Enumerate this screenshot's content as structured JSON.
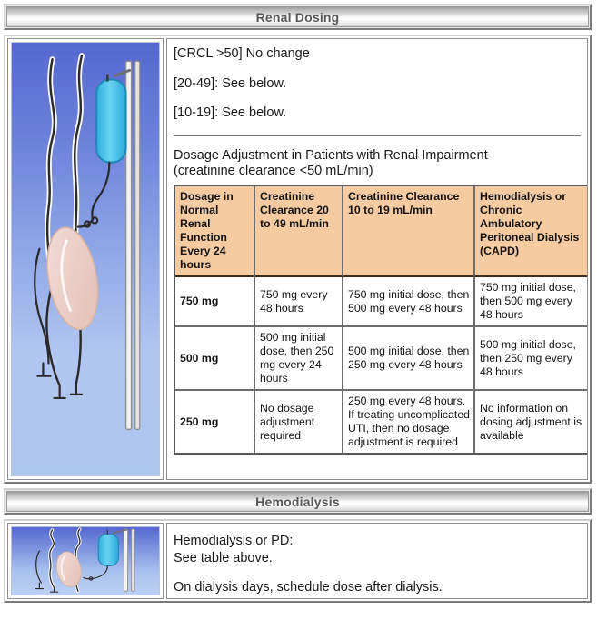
{
  "sections": [
    {
      "title": "Renal Dosing",
      "illustration": "dialysis-patient-icon",
      "crcl_lines": [
        "[CRCL >50] No change",
        "[20-49]: See below.",
        "[10-19]: See below."
      ],
      "table_caption_line1": "Dosage Adjustment in Patients with Renal Impairment",
      "table_caption_line2": "(creatinine clearance <50 mL/min)",
      "table": {
        "headers": [
          "Dosage in Normal Renal Function Every 24 hours",
          "Creatinine Clearance 20 to 49 mL/min",
          "Creatinine Clearance 10 to 19 mL/min",
          "Hemodialysis or Chronic Ambulatory Peritoneal Dialysis (CAPD)"
        ],
        "rows": [
          {
            "dose": "750 mg",
            "crcl_20_49": "750 mg every 48 hours",
            "crcl_10_19": "750 mg initial dose, then 500 mg every 48 hours",
            "capd": "750 mg initial dose, then 500 mg every 48 hours"
          },
          {
            "dose": "500 mg",
            "crcl_20_49": "500 mg initial dose, then 250 mg every 24 hours",
            "crcl_10_19": "500 mg initial dose, then 250 mg every 48 hours",
            "capd": "500 mg initial dose, then 250 mg every 48 hours"
          },
          {
            "dose": "250 mg",
            "crcl_20_49": "No dosage adjustment required",
            "crcl_10_19": "250 mg every 48 hours. If treating uncomplicated UTI, then no dosage adjustment is required",
            "capd": "No information on dosing adjustment is available"
          }
        ]
      }
    },
    {
      "title": "Hemodialysis",
      "illustration": "dialysis-patient-icon",
      "line1": "Hemodialysis or PD:",
      "line2": "See table above.",
      "line3": "On dialysis days, schedule dose after dialysis."
    }
  ],
  "colors": {
    "table_header_bg": "#f7cba2",
    "title_text": "#575757",
    "illustration_top": "#5e73d4",
    "illustration_bottom": "#bcd0f2",
    "dialysis_bag": "#4fc3e8",
    "kidney": "#e8c9bf"
  }
}
